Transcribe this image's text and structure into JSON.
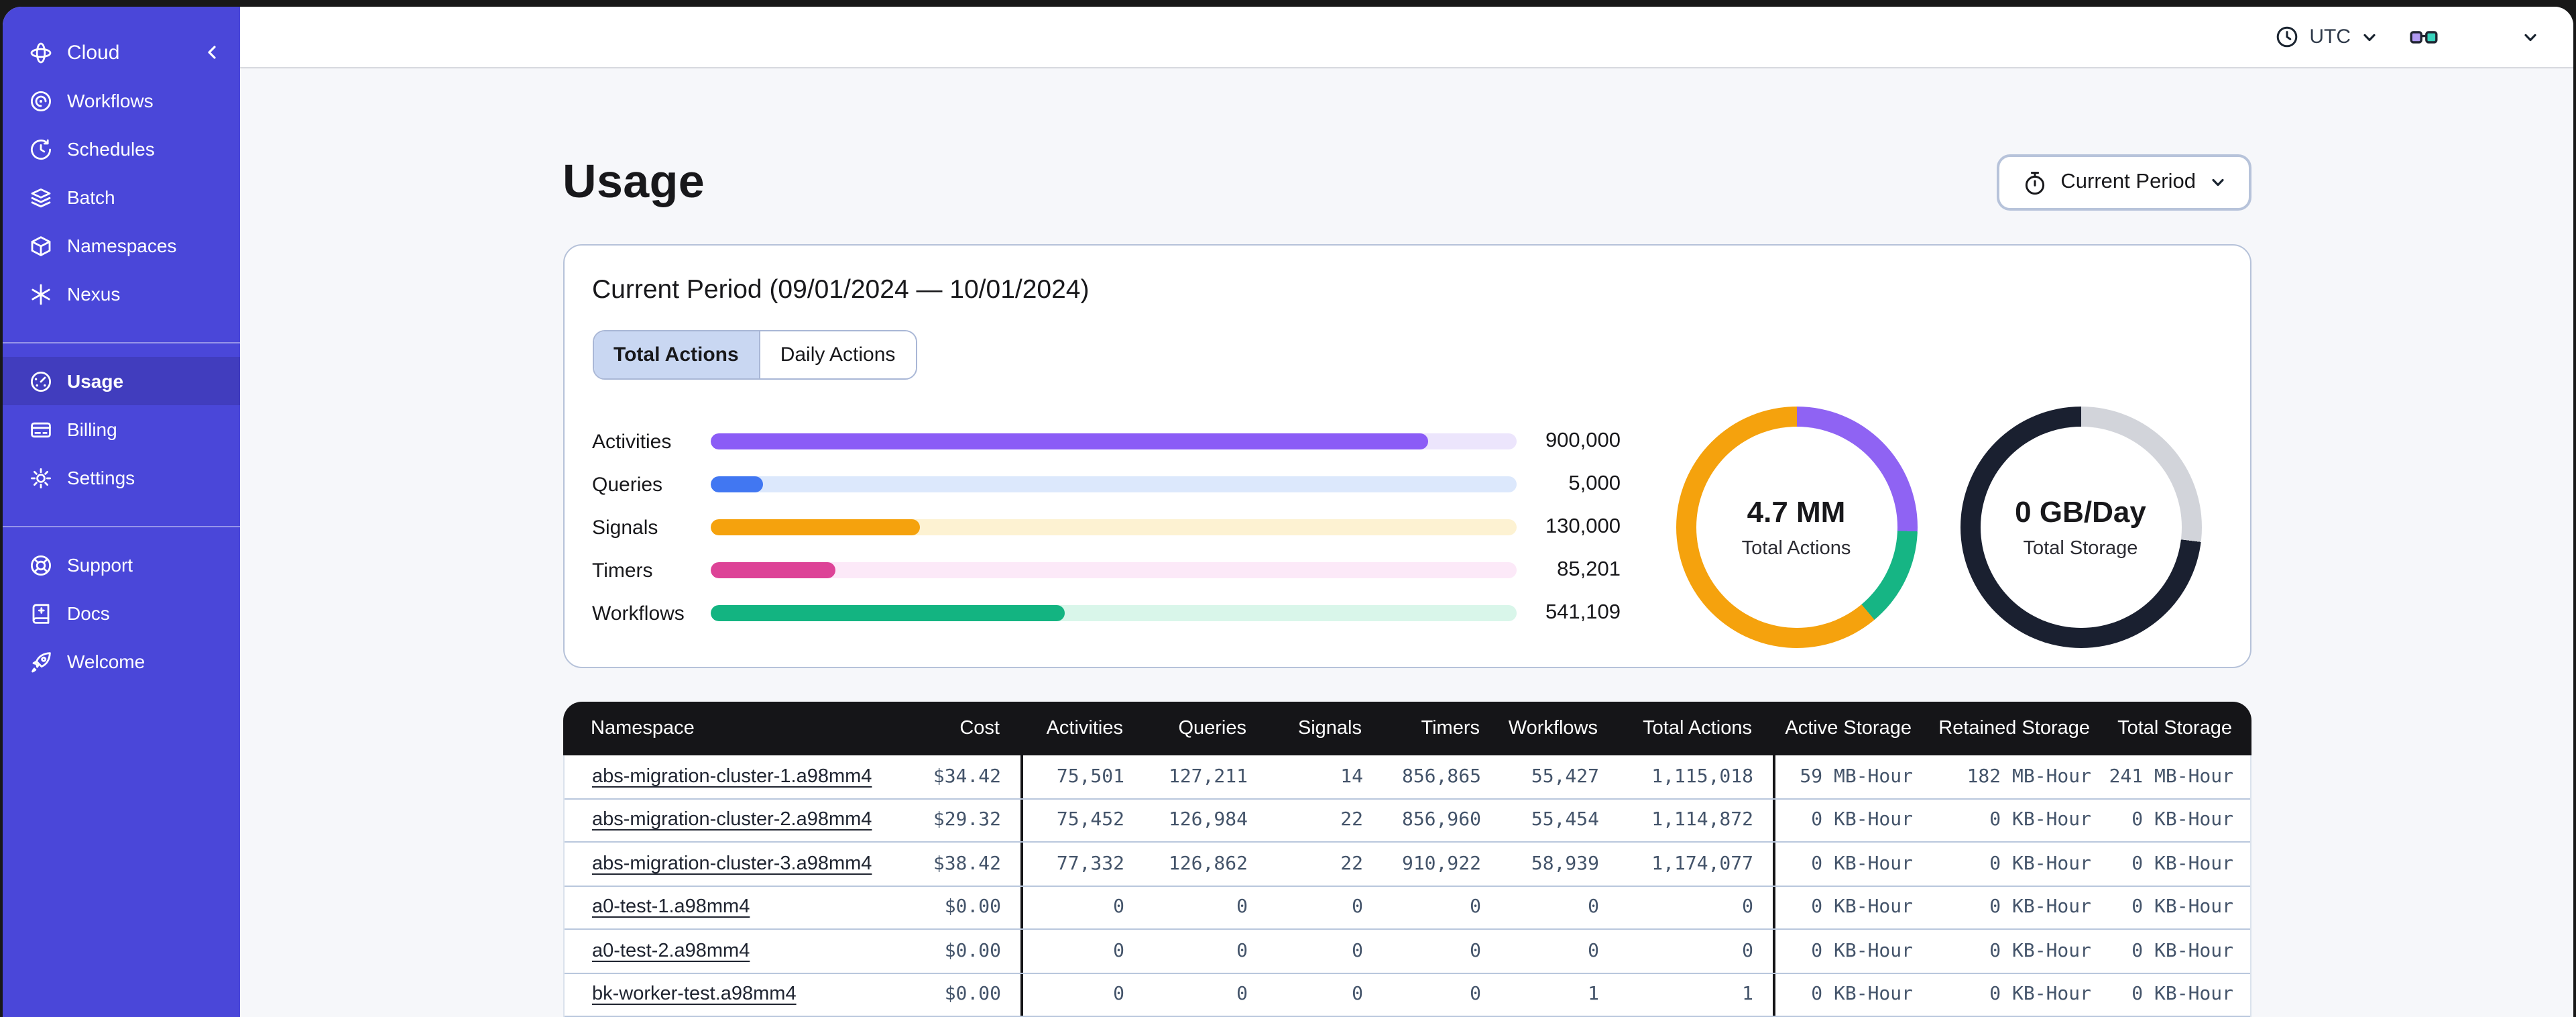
{
  "topbar": {
    "timezone": "UTC"
  },
  "sidebar": {
    "brand": "Cloud",
    "groups": [
      {
        "items": [
          {
            "label": "Workflows",
            "icon": "workflows",
            "active": false
          },
          {
            "label": "Schedules",
            "icon": "schedules",
            "active": false
          },
          {
            "label": "Batch",
            "icon": "batch",
            "active": false
          },
          {
            "label": "Namespaces",
            "icon": "namespaces",
            "active": false
          },
          {
            "label": "Nexus",
            "icon": "nexus",
            "active": false
          }
        ]
      },
      {
        "items": [
          {
            "label": "Usage",
            "icon": "usage",
            "active": true
          },
          {
            "label": "Billing",
            "icon": "billing",
            "active": false
          },
          {
            "label": "Settings",
            "icon": "settings",
            "active": false
          }
        ]
      },
      {
        "items": [
          {
            "label": "Support",
            "icon": "support",
            "active": false
          },
          {
            "label": "Docs",
            "icon": "docs",
            "active": false
          },
          {
            "label": "Welcome",
            "icon": "welcome",
            "active": false
          }
        ]
      }
    ]
  },
  "page": {
    "title": "Usage",
    "period_button": "Current Period"
  },
  "usage_card": {
    "title": "Current Period (09/01/2024 — 10/01/2024)",
    "tabs": [
      {
        "label": "Total Actions",
        "active": true
      },
      {
        "label": "Daily Actions",
        "active": false
      }
    ],
    "bars": [
      {
        "label": "Activities",
        "value": "900,000",
        "percent": 89.1,
        "color": "#8b5cf6",
        "track": "#ece5fc"
      },
      {
        "label": "Queries",
        "value": "5,000",
        "percent": 6.5,
        "color": "#4177f2",
        "track": "#dce8fc"
      },
      {
        "label": "Signals",
        "value": "130,000",
        "percent": 26,
        "color": "#f5a20d",
        "track": "#fdf2d2"
      },
      {
        "label": "Timers",
        "value": "85,201",
        "percent": 15.5,
        "color": "#dd4397",
        "track": "#fce9f8"
      },
      {
        "label": "Workflows",
        "value": "541,109",
        "percent": 44,
        "color": "#13b481",
        "track": "#d9f6ea"
      }
    ],
    "donuts": [
      {
        "value": "4.7 MM",
        "label": "Total Actions",
        "segments": [
          {
            "color": "#8f63f3",
            "deg": 92
          },
          {
            "color": "#16b584",
            "deg": 48
          },
          {
            "color": "#f5a20d",
            "deg": 220
          }
        ]
      },
      {
        "value": "0 GB/Day",
        "label": "Total Storage",
        "segments": [
          {
            "color": "#d2d4da",
            "deg": 97
          },
          {
            "color": "#1a2030",
            "deg": 263
          }
        ]
      }
    ]
  },
  "table": {
    "columns": [
      {
        "key": "namespace",
        "label": "Namespace",
        "align": "left"
      },
      {
        "key": "cost",
        "label": "Cost",
        "align": "right"
      },
      {
        "key": "activities",
        "label": "Activities",
        "align": "right",
        "divider": true
      },
      {
        "key": "queries",
        "label": "Queries",
        "align": "right"
      },
      {
        "key": "signals",
        "label": "Signals",
        "align": "right"
      },
      {
        "key": "timers",
        "label": "Timers",
        "align": "right"
      },
      {
        "key": "workflows",
        "label": "Workflows",
        "align": "right"
      },
      {
        "key": "total_actions",
        "label": "Total Actions",
        "align": "right"
      },
      {
        "key": "active_storage",
        "label": "Active Storage",
        "align": "right",
        "divider": true
      },
      {
        "key": "retained_storage",
        "label": "Retained Storage",
        "align": "right"
      },
      {
        "key": "total_storage",
        "label": "Total Storage",
        "align": "right"
      }
    ],
    "rows": [
      {
        "namespace": "abs-migration-cluster-1.a98mm4",
        "cost": "$34.42",
        "activities": "75,501",
        "queries": "127,211",
        "signals": "14",
        "timers": "856,865",
        "workflows": "55,427",
        "total_actions": "1,115,018",
        "active_storage": "59 MB-Hour",
        "retained_storage": "182 MB-Hour",
        "total_storage": "241 MB-Hour"
      },
      {
        "namespace": "abs-migration-cluster-2.a98mm4",
        "cost": "$29.32",
        "activities": "75,452",
        "queries": "126,984",
        "signals": "22",
        "timers": "856,960",
        "workflows": "55,454",
        "total_actions": "1,114,872",
        "active_storage": "0 KB-Hour",
        "retained_storage": "0 KB-Hour",
        "total_storage": "0 KB-Hour"
      },
      {
        "namespace": "abs-migration-cluster-3.a98mm4",
        "cost": "$38.42",
        "activities": "77,332",
        "queries": "126,862",
        "signals": "22",
        "timers": "910,922",
        "workflows": "58,939",
        "total_actions": "1,174,077",
        "active_storage": "0 KB-Hour",
        "retained_storage": "0 KB-Hour",
        "total_storage": "0 KB-Hour"
      },
      {
        "namespace": "a0-test-1.a98mm4",
        "cost": "$0.00",
        "activities": "0",
        "queries": "0",
        "signals": "0",
        "timers": "0",
        "workflows": "0",
        "total_actions": "0",
        "active_storage": "0 KB-Hour",
        "retained_storage": "0 KB-Hour",
        "total_storage": "0 KB-Hour"
      },
      {
        "namespace": "a0-test-2.a98mm4",
        "cost": "$0.00",
        "activities": "0",
        "queries": "0",
        "signals": "0",
        "timers": "0",
        "workflows": "0",
        "total_actions": "0",
        "active_storage": "0 KB-Hour",
        "retained_storage": "0 KB-Hour",
        "total_storage": "0 KB-Hour"
      },
      {
        "namespace": "bk-worker-test.a98mm4",
        "cost": "$0.00",
        "activities": "0",
        "queries": "0",
        "signals": "0",
        "timers": "0",
        "workflows": "1",
        "total_actions": "1",
        "active_storage": "0 KB-Hour",
        "retained_storage": "0 KB-Hour",
        "total_storage": "0 KB-Hour"
      }
    ]
  },
  "chart_data": [
    {
      "type": "bar",
      "orientation": "horizontal",
      "categories": [
        "Activities",
        "Queries",
        "Signals",
        "Timers",
        "Workflows"
      ],
      "values": [
        900000,
        5000,
        130000,
        85201,
        541109
      ],
      "value_labels": [
        "900,000",
        "5,000",
        "130,000",
        "85,201",
        "541,109"
      ],
      "title": "",
      "xlabel": "",
      "ylabel": ""
    },
    {
      "type": "pie",
      "title": "Total Actions",
      "center_value": "4.7 MM",
      "center_label": "Total Actions",
      "segments": [
        {
          "color": "#8f63f3",
          "sweep_deg": 92
        },
        {
          "color": "#16b584",
          "sweep_deg": 48
        },
        {
          "color": "#f5a20d",
          "sweep_deg": 220
        }
      ]
    },
    {
      "type": "pie",
      "title": "Total Storage",
      "center_value": "0 GB/Day",
      "center_label": "Total Storage",
      "segments": [
        {
          "color": "#d2d4da",
          "sweep_deg": 97
        },
        {
          "color": "#1a2030",
          "sweep_deg": 263
        }
      ]
    }
  ]
}
